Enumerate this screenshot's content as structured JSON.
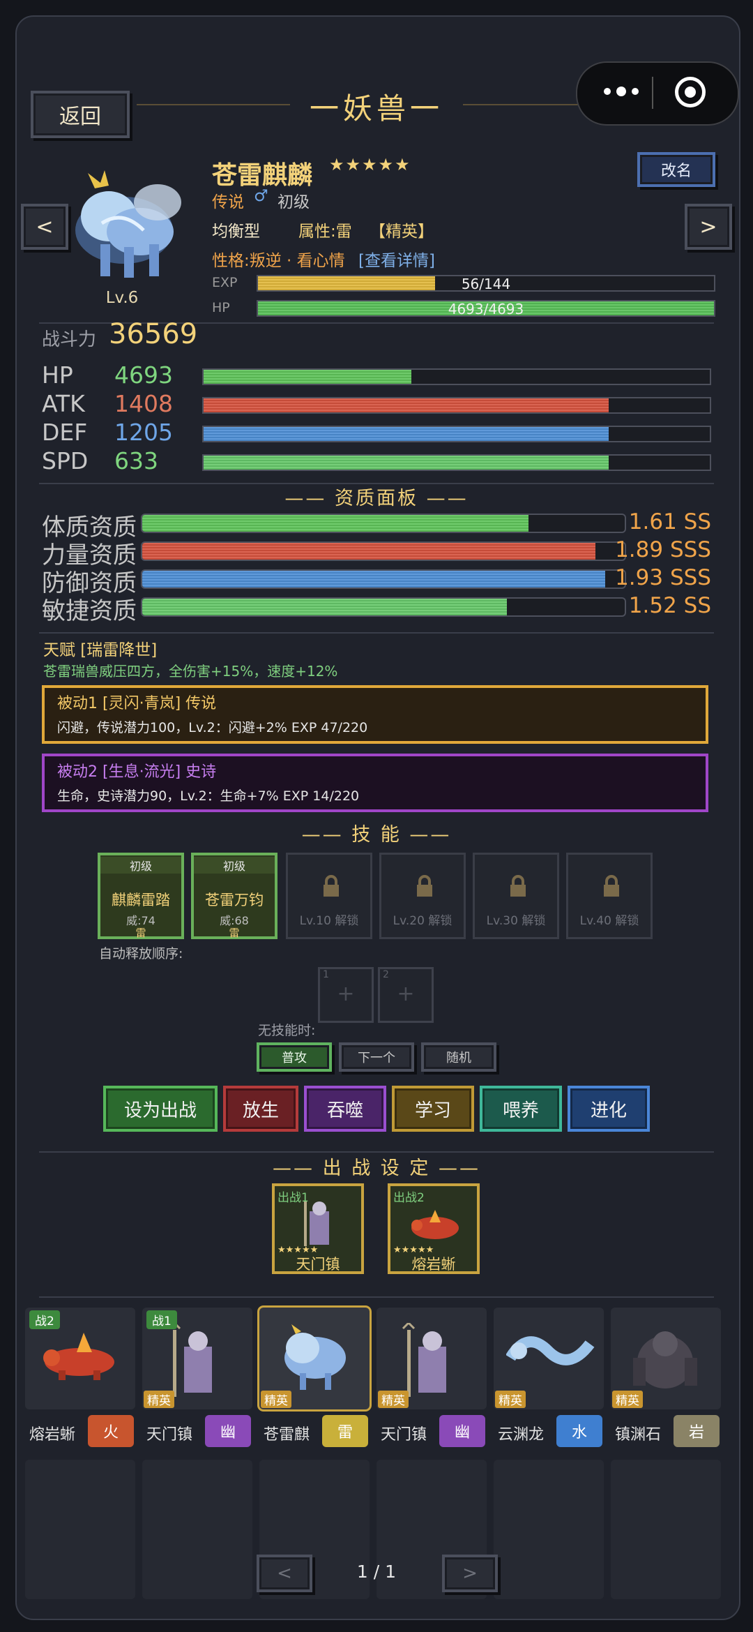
{
  "header": {
    "back_label": "返回",
    "title": "一妖兽一"
  },
  "pet": {
    "name": "苍雷麒麟",
    "stars": "★★★★★",
    "rarity": "传说",
    "gender_icon": "♂",
    "stage": "初级",
    "role": "均衡型",
    "attribute": "属性:雷",
    "grade": "【精英】",
    "personality": "性格:叛逆 · 看心情",
    "detail_link": "[查看详情]",
    "level": "Lv.6",
    "rename_label": "改名",
    "prev_label": "<",
    "next_label": ">",
    "exp_label": "EXP",
    "exp_text": "56/144",
    "exp_fraction": 0.389,
    "hp_label": "HP",
    "hp_text": "4693/4693",
    "hp_fraction": 1.0
  },
  "combat": {
    "label": "战斗力",
    "value": "36569"
  },
  "stats": [
    {
      "label": "HP",
      "value": "4693",
      "fraction": 0.41,
      "color": "#5fc45a"
    },
    {
      "label": "ATK",
      "value": "1408",
      "fraction": 0.8,
      "color": "#d6533e"
    },
    {
      "label": "DEF",
      "value": "1205",
      "fraction": 0.8,
      "color": "#4e8fd6"
    },
    {
      "label": "SPD",
      "value": "633",
      "fraction": 0.8,
      "color": "#66c86a"
    }
  ],
  "aptitude_title": "—— 资质面板 ——",
  "aptitudes": [
    {
      "label": "体质资质",
      "value": "1.61 SS",
      "fraction": 0.8,
      "color": "#5fc45a"
    },
    {
      "label": "力量资质",
      "value": "1.89 SSS",
      "fraction": 0.94,
      "color": "#d6533e"
    },
    {
      "label": "防御资质",
      "value": "1.93 SSS",
      "fraction": 0.96,
      "color": "#4e8fd6"
    },
    {
      "label": "敏捷资质",
      "value": "1.52 SS",
      "fraction": 0.756,
      "color": "#66c86a"
    }
  ],
  "talent": {
    "title": "天赋 [瑞雷降世]",
    "desc": "苍雷瑞兽威压四方，全伤害+15%，速度+12%"
  },
  "passives": [
    {
      "title": "被动1 [灵闪·青岚] 传说",
      "desc": "闪避，传说潜力100，Lv.2：闪避+2%  EXP 47/220",
      "border": "#e0a83a",
      "bg": "#2a2012",
      "title_color": "#f3c867"
    },
    {
      "title": "被动2 [生息·流光] 史诗",
      "desc": "生命，史诗潜力90，Lv.2：生命+7%  EXP 14/220",
      "border": "#a046c8",
      "bg": "#1c1022",
      "title_color": "#c77ef0"
    }
  ],
  "skills_title": "—— 技 能 ——",
  "skills": [
    {
      "tier": "初级",
      "name": "麒麟雷踏",
      "power": "威:74",
      "elem": "雷"
    },
    {
      "tier": "初级",
      "name": "苍雷万钧",
      "power": "威:68",
      "elem": "雷"
    }
  ],
  "locked_slots": [
    "Lv.10 解锁",
    "Lv.20 解锁",
    "Lv.30 解锁",
    "Lv.40 解锁"
  ],
  "auto_order": {
    "label": "自动释放顺序:",
    "slots": [
      "1",
      "2"
    ],
    "plus": "+"
  },
  "no_skill": {
    "label": "无技能时:",
    "options": [
      "普攻",
      "下一个",
      "随机"
    ]
  },
  "actions": [
    {
      "label": "设为出战",
      "border": "#56b85a",
      "bg": "#2b6a2e"
    },
    {
      "label": "放生",
      "border": "#b53b3b",
      "bg": "#6a2024"
    },
    {
      "label": "吞噬",
      "border": "#9a4fd0",
      "bg": "#4a2468"
    },
    {
      "label": "学习",
      "border": "#c09a36",
      "bg": "#5a4818"
    },
    {
      "label": "喂养",
      "border": "#3fb89a",
      "bg": "#1c5a4c"
    },
    {
      "label": "进化",
      "border": "#4a86d8",
      "bg": "#1f3f70"
    }
  ],
  "battle_title": "—— 出 战 设 定 ——",
  "battle_slots": [
    {
      "tag": "出战1",
      "stars": "★★★★★",
      "name": "天门镇"
    },
    {
      "tag": "出战2",
      "stars": "★★★★★",
      "name": "熔岩蜥"
    }
  ],
  "roster": [
    {
      "name": "熔岩蜥",
      "elem": "火",
      "elem_color": "#c8552e",
      "badge": "战2",
      "elite": ""
    },
    {
      "name": "天门镇",
      "elem": "幽",
      "elem_color": "#8a4ab8",
      "badge": "战1",
      "elite": "精英"
    },
    {
      "name": "苍雷麒",
      "elem": "雷",
      "elem_color": "#c9b03a",
      "badge": "",
      "elite": "精英"
    },
    {
      "name": "天门镇",
      "elem": "幽",
      "elem_color": "#8a4ab8",
      "badge": "",
      "elite": "精英"
    },
    {
      "name": "云渊龙",
      "elem": "水",
      "elem_color": "#3f7fd0",
      "badge": "",
      "elite": "精英"
    },
    {
      "name": "镇渊石",
      "elem": "岩",
      "elem_color": "#8a8366",
      "badge": "",
      "elite": "精英"
    }
  ],
  "pager": {
    "prev": "<",
    "page": "1 / 1",
    "next": ">"
  }
}
